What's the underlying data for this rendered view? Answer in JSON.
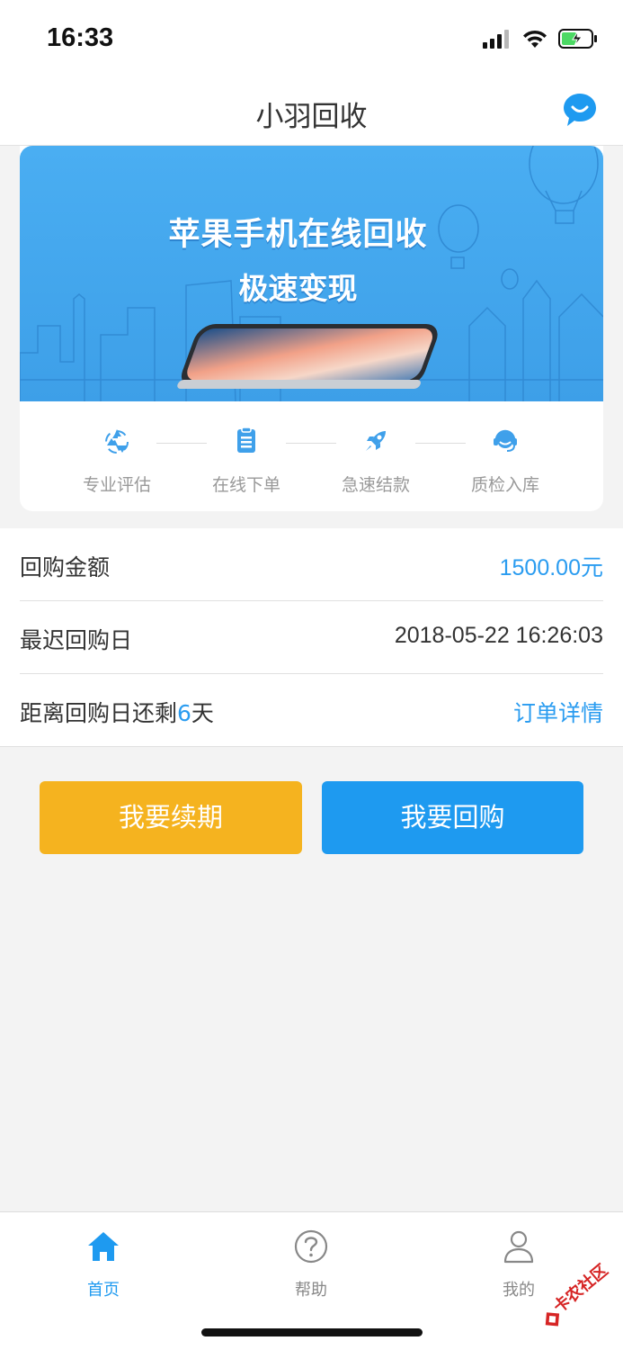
{
  "status_bar": {
    "time": "16:33",
    "icons": [
      "signal-icon",
      "wifi-icon",
      "battery-charging-icon"
    ]
  },
  "nav": {
    "title": "小羽回收",
    "right_icon": "chat-bubble-icon"
  },
  "banner": {
    "line1": "苹果手机在线回收",
    "line2": "极速变现",
    "steps": [
      {
        "icon": "recycle-icon",
        "label": "专业评估"
      },
      {
        "icon": "clipboard-icon",
        "label": "在线下单"
      },
      {
        "icon": "rocket-icon",
        "label": "急速结款"
      },
      {
        "icon": "headset-icon",
        "label": "质检入库"
      }
    ]
  },
  "info": {
    "amount_label": "回购金额",
    "amount_value": "1500.00元",
    "deadline_label": "最迟回购日",
    "deadline_value": "2018-05-22 16:26:03",
    "remaining_prefix": "距离回购日还剩",
    "remaining_days": "6",
    "remaining_suffix": "天",
    "detail_link": "订单详情"
  },
  "actions": {
    "renew": "我要续期",
    "buyback": "我要回购"
  },
  "tabs": [
    {
      "icon": "home-icon",
      "label": "首页",
      "active": true
    },
    {
      "icon": "help-icon",
      "label": "帮助",
      "active": false
    },
    {
      "icon": "user-icon",
      "label": "我的",
      "active": false
    }
  ],
  "watermark": {
    "text": "卡农社区"
  },
  "colors": {
    "accent_blue": "#1e9af0",
    "accent_yellow": "#f5b31f",
    "banner_blue": "#4aaaf0"
  }
}
